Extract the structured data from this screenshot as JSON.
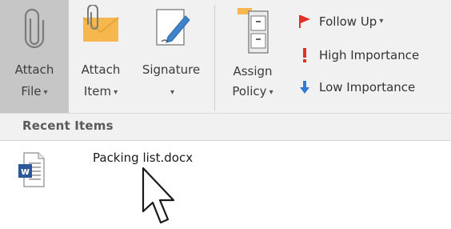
{
  "ribbon": {
    "attach_file": {
      "line1": "Attach",
      "line2": "File",
      "has_menu": true,
      "pressed": true
    },
    "attach_item": {
      "line1": "Attach",
      "line2": "Item",
      "has_menu": true
    },
    "signature": {
      "line1": "Signature",
      "line2": "",
      "has_menu": true
    },
    "assign_policy": {
      "line1": "Assign",
      "line2": "Policy",
      "has_menu": true
    },
    "tags": {
      "follow_up": "Follow Up",
      "high_importance": "High Importance",
      "low_importance": "Low Importance"
    },
    "caret_glyph": "▾"
  },
  "recent": {
    "header": "Recent Items",
    "items": [
      {
        "name": "Packing list.docx",
        "icon": "word-document-icon"
      }
    ]
  },
  "colors": {
    "ribbon_bg": "#f1f1f1",
    "pressed_bg": "#c6c6c6",
    "flag_red": "#e0302a",
    "importance_high": "#e0302a",
    "importance_low": "#2f7bd6",
    "word_blue": "#2b579a",
    "envelope_orange": "#f6b84e"
  }
}
